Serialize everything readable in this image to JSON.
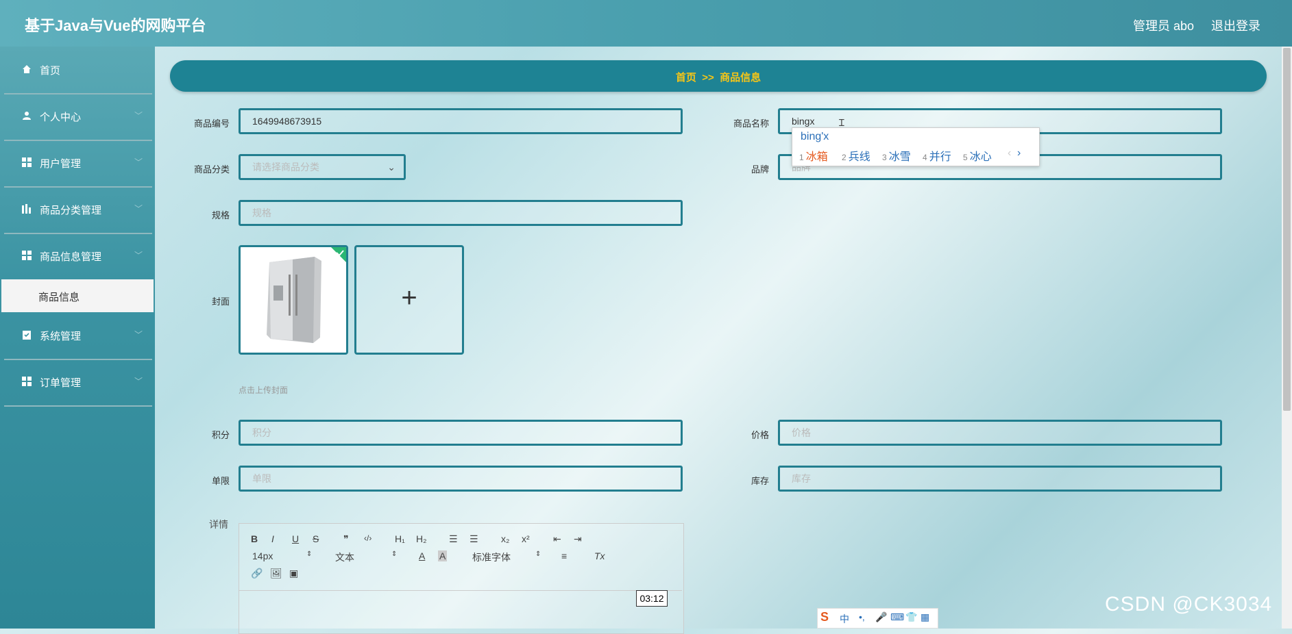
{
  "header": {
    "title": "基于Java与Vue的网购平台",
    "user": "管理员 abo",
    "logout": "退出登录"
  },
  "sidebar": {
    "items": [
      {
        "label": "首页",
        "icon": "home-icon"
      },
      {
        "label": "个人中心",
        "icon": "user-icon"
      },
      {
        "label": "用户管理",
        "icon": "grid-icon"
      },
      {
        "label": "商品分类管理",
        "icon": "chart-icon"
      },
      {
        "label": "商品信息管理",
        "icon": "grid-icon"
      },
      {
        "label": "系统管理",
        "icon": "clipboard-icon"
      },
      {
        "label": "订单管理",
        "icon": "grid-icon"
      }
    ],
    "sub_item": "商品信息"
  },
  "breadcrumb": {
    "home": "首页",
    "sep": ">>",
    "current": "商品信息"
  },
  "form": {
    "code_label": "商品编号",
    "code_value": "1649948673915",
    "name_label": "商品名称",
    "name_value": "bingx",
    "category_label": "商品分类",
    "category_placeholder": "请选择商品分类",
    "brand_label": "品牌",
    "brand_placeholder": "品牌",
    "spec_label": "规格",
    "spec_placeholder": "规格",
    "cover_label": "封面",
    "cover_hint": "点击上传封面",
    "upload_plus": "+",
    "points_label": "积分",
    "points_placeholder": "积分",
    "price_label": "价格",
    "price_placeholder": "价格",
    "limit_label": "单限",
    "limit_placeholder": "单限",
    "stock_label": "库存",
    "stock_placeholder": "库存",
    "detail_label": "详情"
  },
  "ime": {
    "composition": "bing'x",
    "candidates": [
      {
        "num": "1",
        "text": "冰箱"
      },
      {
        "num": "2",
        "text": "兵线"
      },
      {
        "num": "3",
        "text": "冰雪"
      },
      {
        "num": "4",
        "text": "并行"
      },
      {
        "num": "5",
        "text": "冰心"
      }
    ],
    "prev": "‹",
    "next": "›"
  },
  "editor": {
    "bold": "B",
    "italic": "I",
    "underline": "U",
    "strike": "S",
    "quote": "❞",
    "code": "‹/›",
    "h1": "H₁",
    "h2": "H₂",
    "ol": "☰",
    "ul": "☰",
    "sub": "x₂",
    "sup": "x²",
    "outdent": "⇤",
    "indent": "⇥",
    "size": "14px",
    "font_type": "文本",
    "font_family": "标准字体",
    "color": "A",
    "bg": "A",
    "align": "≡",
    "clear": "Tx"
  },
  "time_badge": "03:12",
  "watermark": "CSDN @CK3034",
  "colors": {
    "primary": "#227e8f",
    "breadcrumb": "#1e8394",
    "accent": "#f5c518"
  }
}
